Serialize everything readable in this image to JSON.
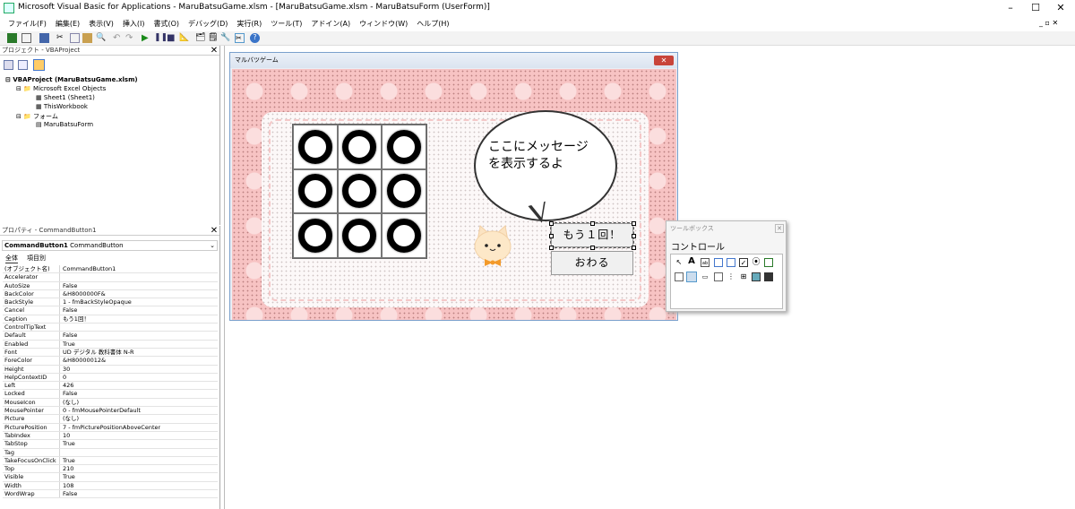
{
  "window": {
    "title": "Microsoft Visual Basic for Applications - MaruBatsuGame.xlsm - [MaruBatsuGame.xlsm - MaruBatsuForm (UserForm)]"
  },
  "menu": [
    "ファイル(F)",
    "編集(E)",
    "表示(V)",
    "挿入(I)",
    "書式(O)",
    "デバッグ(D)",
    "実行(R)",
    "ツール(T)",
    "アドイン(A)",
    "ウィンドウ(W)",
    "ヘルプ(H)"
  ],
  "project": {
    "title": "プロジェクト - VBAProject",
    "root": "VBAProject (MaruBatsuGame.xlsm)",
    "excel_objects": "Microsoft Excel Objects",
    "sheet1": "Sheet1 (Sheet1)",
    "workbook": "ThisWorkbook",
    "forms": "フォーム",
    "form": "MaruBatsuForm"
  },
  "properties": {
    "title": "プロパティ - CommandButton1",
    "object_name": "CommandButton1",
    "object_type": "CommandButton",
    "tab_all": "全体",
    "tab_category": "項目別",
    "rows": [
      [
        "(オブジェクト名)",
        "CommandButton1"
      ],
      [
        "Accelerator",
        ""
      ],
      [
        "AutoSize",
        "False"
      ],
      [
        "BackColor",
        "&H8000000F&"
      ],
      [
        "BackStyle",
        "1 - fmBackStyleOpaque"
      ],
      [
        "Cancel",
        "False"
      ],
      [
        "Caption",
        "もう1回！"
      ],
      [
        "ControlTipText",
        ""
      ],
      [
        "Default",
        "False"
      ],
      [
        "Enabled",
        "True"
      ],
      [
        "Font",
        "UD デジタル 教科書体 N-R"
      ],
      [
        "ForeColor",
        "&H80000012&"
      ],
      [
        "Height",
        "30"
      ],
      [
        "HelpContextID",
        "0"
      ],
      [
        "Left",
        "426"
      ],
      [
        "Locked",
        "False"
      ],
      [
        "MouseIcon",
        "(なし)"
      ],
      [
        "MousePointer",
        "0 - fmMousePointerDefault"
      ],
      [
        "Picture",
        "(なし)"
      ],
      [
        "PicturePosition",
        "7 - fmPicturePositionAboveCenter"
      ],
      [
        "TabIndex",
        "10"
      ],
      [
        "TabStop",
        "True"
      ],
      [
        "Tag",
        ""
      ],
      [
        "TakeFocusOnClick",
        "True"
      ],
      [
        "Top",
        "210"
      ],
      [
        "Visible",
        "True"
      ],
      [
        "Width",
        "108"
      ],
      [
        "WordWrap",
        "False"
      ]
    ]
  },
  "form": {
    "title": "マルバツゲーム",
    "message": [
      "ここにメッセージ",
      "を表示するよ"
    ],
    "retry": "もう１回！",
    "quit": "おわる"
  },
  "toolbox": {
    "title": "ツールボックス",
    "tab": "コントロール"
  }
}
